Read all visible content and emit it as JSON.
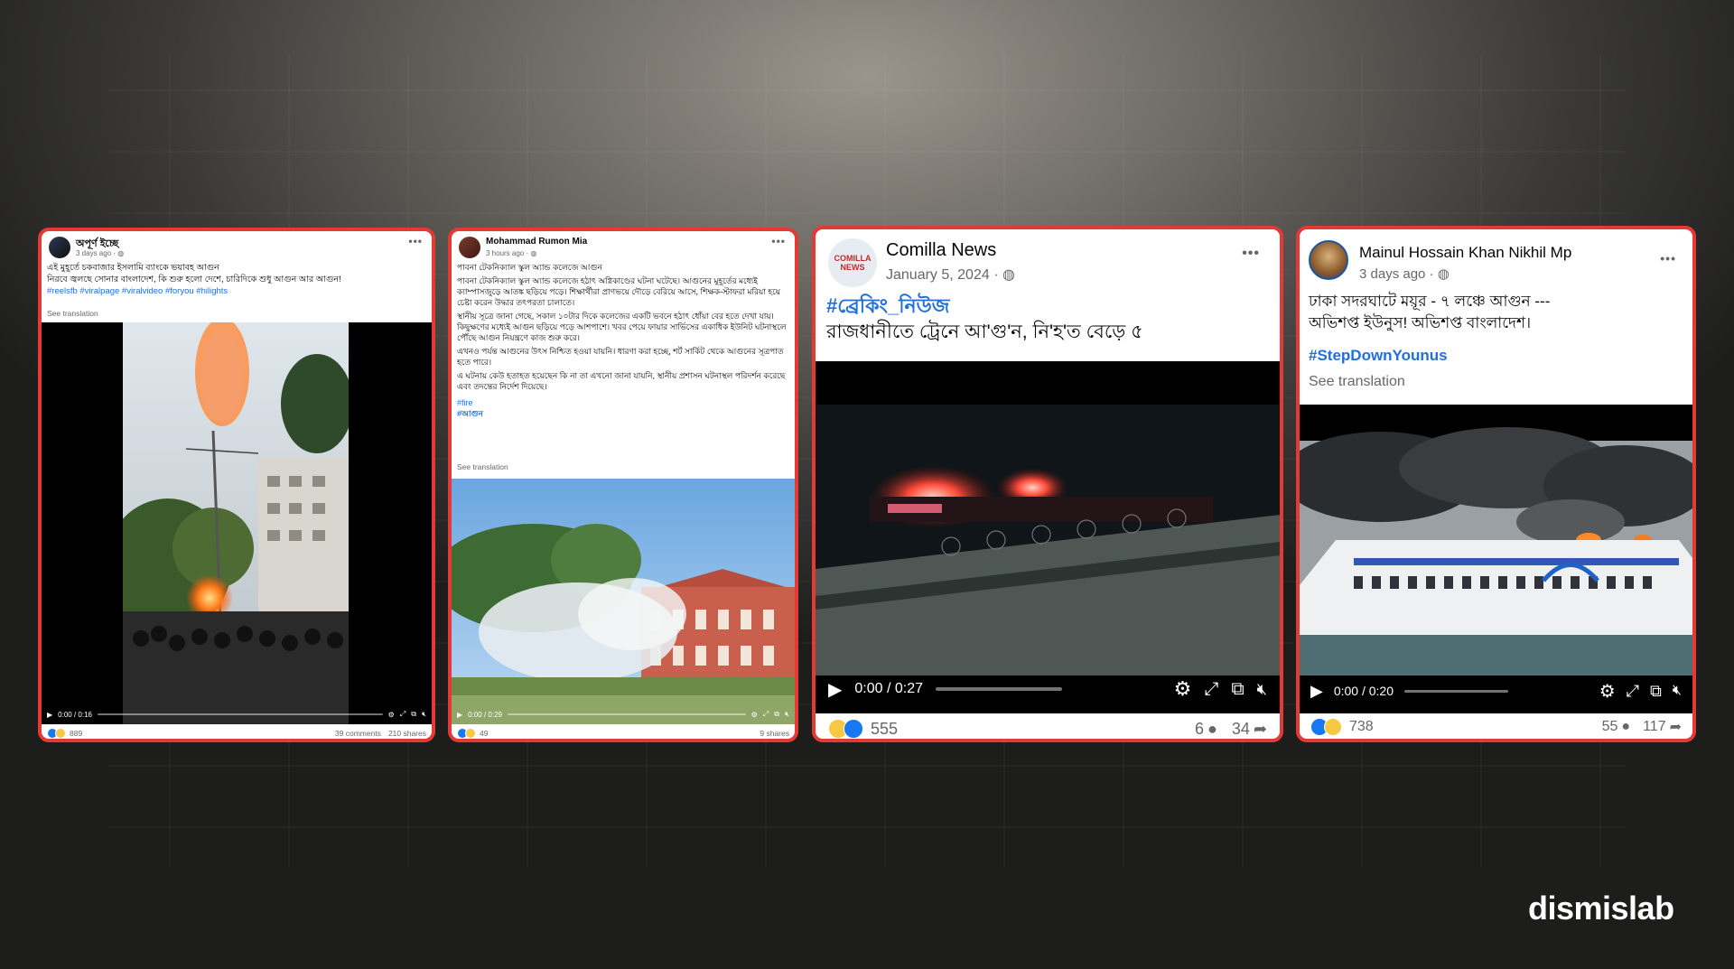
{
  "brand": {
    "logo_text": "dismislab"
  },
  "colors": {
    "highlight_border": "#e53935",
    "link": "#216fdb",
    "like": "#1877f2"
  },
  "posts": [
    {
      "author": "অপূর্ণ ইচ্ছে",
      "time": "3 days ago",
      "text_lines": [
        "এই মুহূর্তে চকবাজার ইসলামি ব্যাংকে ভয়াবহ আগুন",
        "নিরবে জ্বলছে সোনার বাংলাদেশ, কি শুরু হলো দেশে, চারিদিকে শুধু আগুন আর আগুন!"
      ],
      "hashtags": "#reelsfb #viralpage #viralvideo #foryou #hilights",
      "see_translation": "See translation",
      "video_time": "0:00 / 0:16",
      "reactions": "889",
      "comments": "39 comments",
      "shares": "210 shares"
    },
    {
      "author": "Mohammad Rumon Mia",
      "time": "3 hours ago",
      "text_lines": [
        "পাবনা টেকনিক্যাল স্কুল অ্যান্ড কলেজে আগুন",
        "পাবনা টেকনিক্যাল স্কুল অ্যান্ড কলেজে হঠাৎ অগ্নিকাণ্ডের ঘটনা ঘটেছে। আগুনের মুহূর্তের মধ্যেই ক্যাম্পাসজুড়ে আতঙ্ক ছড়িয়ে পড়ে। শিক্ষার্থীরা প্রাণভয়ে দৌড়ে বেরিয়ে আসে, শিক্ষক-স্টাফরা মরিয়া হয়ে চেষ্টা করেন উদ্ধার তৎপরতা চালাতে।",
        "স্থানীয় সূত্রে জানা গেছে, সকাল ১০টার দিকে কলেজের একটি ভবনে হঠাৎ ধোঁয়া বের হতে দেখা যায়। কিছুক্ষণের মধ্যেই আগুন ছড়িয়ে পড়ে আশপাশে। খবর পেয়ে ফায়ার সার্ভিসের একাধিক ইউনিট ঘটনাস্থলে পৌঁছে আগুন নিয়ন্ত্রণে কাজ শুরু করে।",
        "এখনও পর্যন্ত আগুনের উৎস নিশ্চিত হওয়া যায়নি। ধারণা করা হচ্ছে, শর্ট সার্কিট থেকে আগুনের সূত্রপাত হতে পারে।",
        "এ ঘটনায় কেউ হতাহত হয়েছেন কি না তা এখনো জানা যায়নি, স্থানীয় প্রশাসন ঘটনাস্থল পরিদর্শন করেছে এবং তদন্তের নির্দেশ দিয়েছে।"
      ],
      "hashtags": [
        "#fire",
        "#আগুন"
      ],
      "see_translation": "See translation",
      "video_time": "0:00 / 0:29",
      "reactions": "49",
      "shares": "9 shares"
    },
    {
      "author": "Comilla News",
      "time": "January 5, 2024",
      "avatar_text": "COMILLA NEWS",
      "hashtag": "#ব্রেকিং_নিউজ",
      "headline": "রাজধানীতে ট্রেনে আ'গু'ন, নি'হ'ত বেড়ে ৫",
      "video_time": "0:00 / 0:27",
      "reactions": "555",
      "comments": "6",
      "shares": "34"
    },
    {
      "author": "Mainul Hossain Khan Nikhil Mp",
      "time": "3 days ago",
      "text_lines": [
        "ঢাকা সদরঘাটে ময়ূর - ৭ লঞ্চে আগুন ---",
        "অভিশপ্ত ইউনুস! অভিশপ্ত বাংলাদেশ।"
      ],
      "hashtag": "#StepDownYounus",
      "see_translation": "See translation",
      "video_time": "0:00 / 0:20",
      "reactions": "738",
      "comments": "55",
      "shares": "117"
    }
  ]
}
